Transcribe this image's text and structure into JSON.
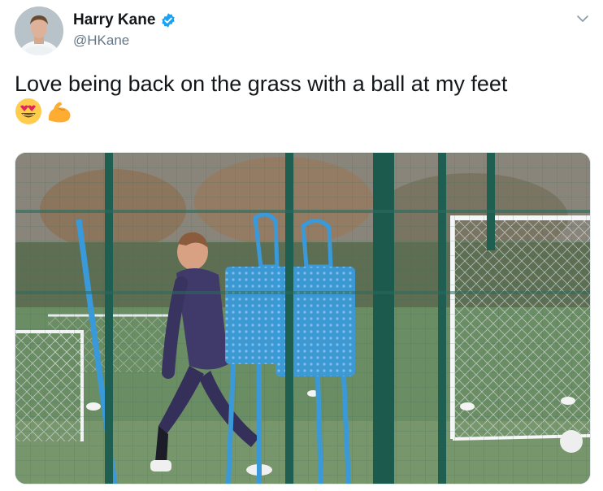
{
  "author": {
    "display_name": "Harry Kane",
    "handle": "@HKane",
    "verified": true,
    "avatar_icon": "profile-photo"
  },
  "tweet": {
    "text": "Love being back on the grass with a ball at my feet",
    "emojis": [
      "heart-eyes-emoji",
      "flexed-biceps-emoji"
    ]
  },
  "media": {
    "kind": "video-still",
    "scene_icon": "training-ground-photo"
  },
  "colors": {
    "verified_blue": "#1da1f2",
    "handle_gray": "#657786",
    "text_dark": "#14171a"
  }
}
